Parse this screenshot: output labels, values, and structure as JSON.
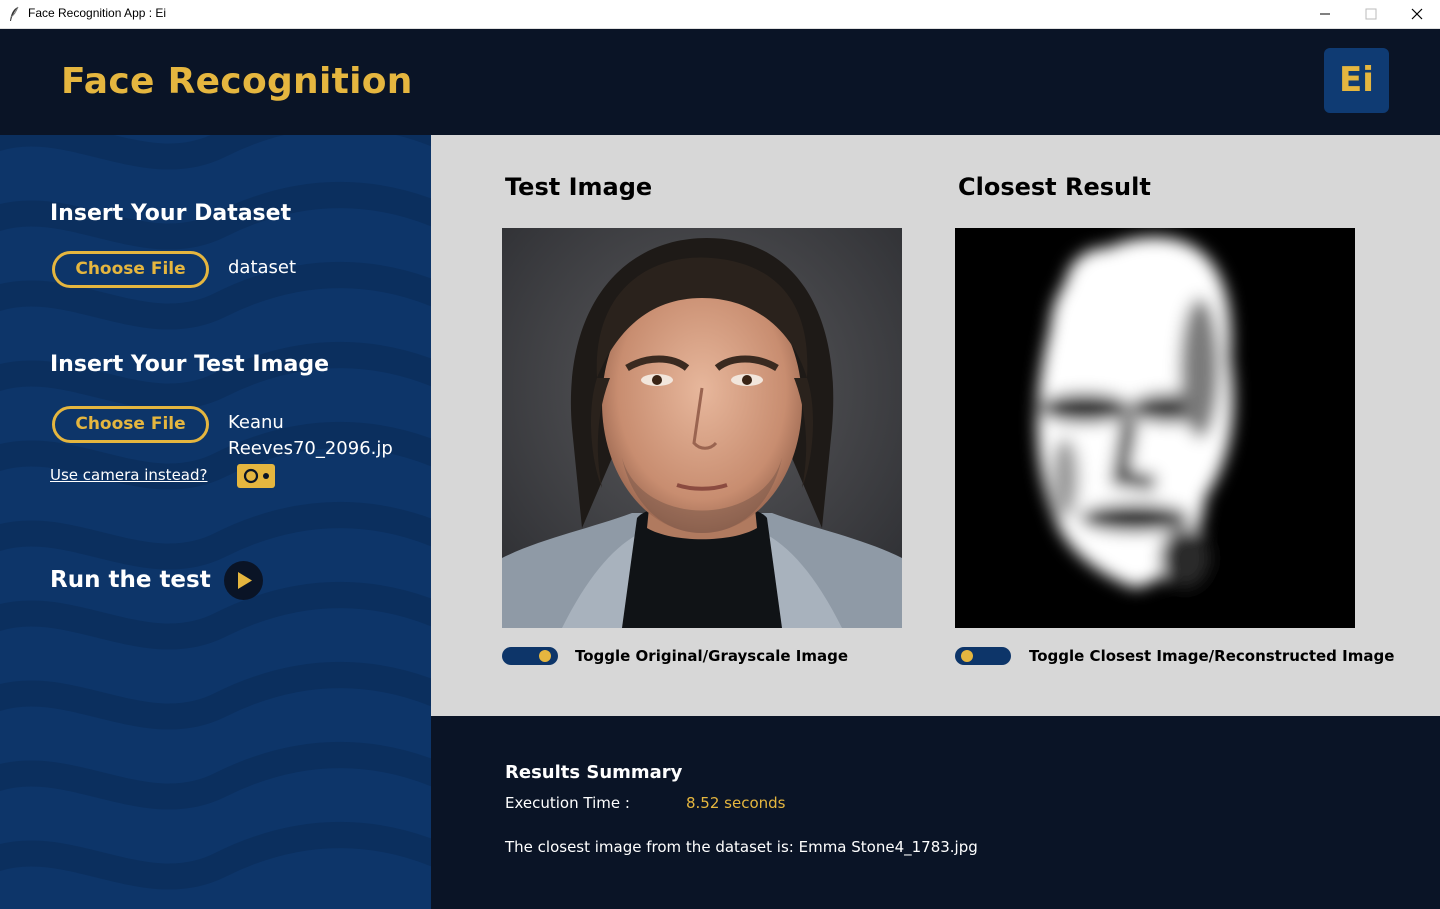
{
  "window": {
    "title": "Face Recognition App : Ei",
    "controls": [
      "minimize-icon",
      "maximize-icon",
      "close-icon"
    ]
  },
  "header": {
    "title": "Face Recognition",
    "logo_text": "Ei"
  },
  "sidebar": {
    "dataset_heading": "Insert Your Dataset",
    "dataset_button": "Choose File",
    "dataset_file": "dataset",
    "test_heading": "Insert Your Test Image",
    "test_button": "Choose File",
    "test_file_line1": "Keanu",
    "test_file_line2": "Reeves70_2096.jp",
    "camera_link": "Use camera instead?",
    "camera_icon": "camera-icon",
    "run_label": "Run the test",
    "run_icon": "play-icon"
  },
  "main": {
    "test_title": "Test Image",
    "result_title": "Closest Result",
    "test_toggle_label": "Toggle Original/Grayscale Image",
    "result_toggle_label": "Toggle Closest Image/Reconstructed Image"
  },
  "results": {
    "title": "Results Summary",
    "exec_label": "Execution Time :",
    "exec_value": "8.52 seconds",
    "closest_text": "The closest image from the dataset is: Emma Stone4_1783.jpg"
  },
  "colors": {
    "accent": "#e5b63f",
    "header_bg": "#0a1426",
    "sidebar_bg": "#0d3569",
    "main_bg": "#d7d7d7"
  }
}
